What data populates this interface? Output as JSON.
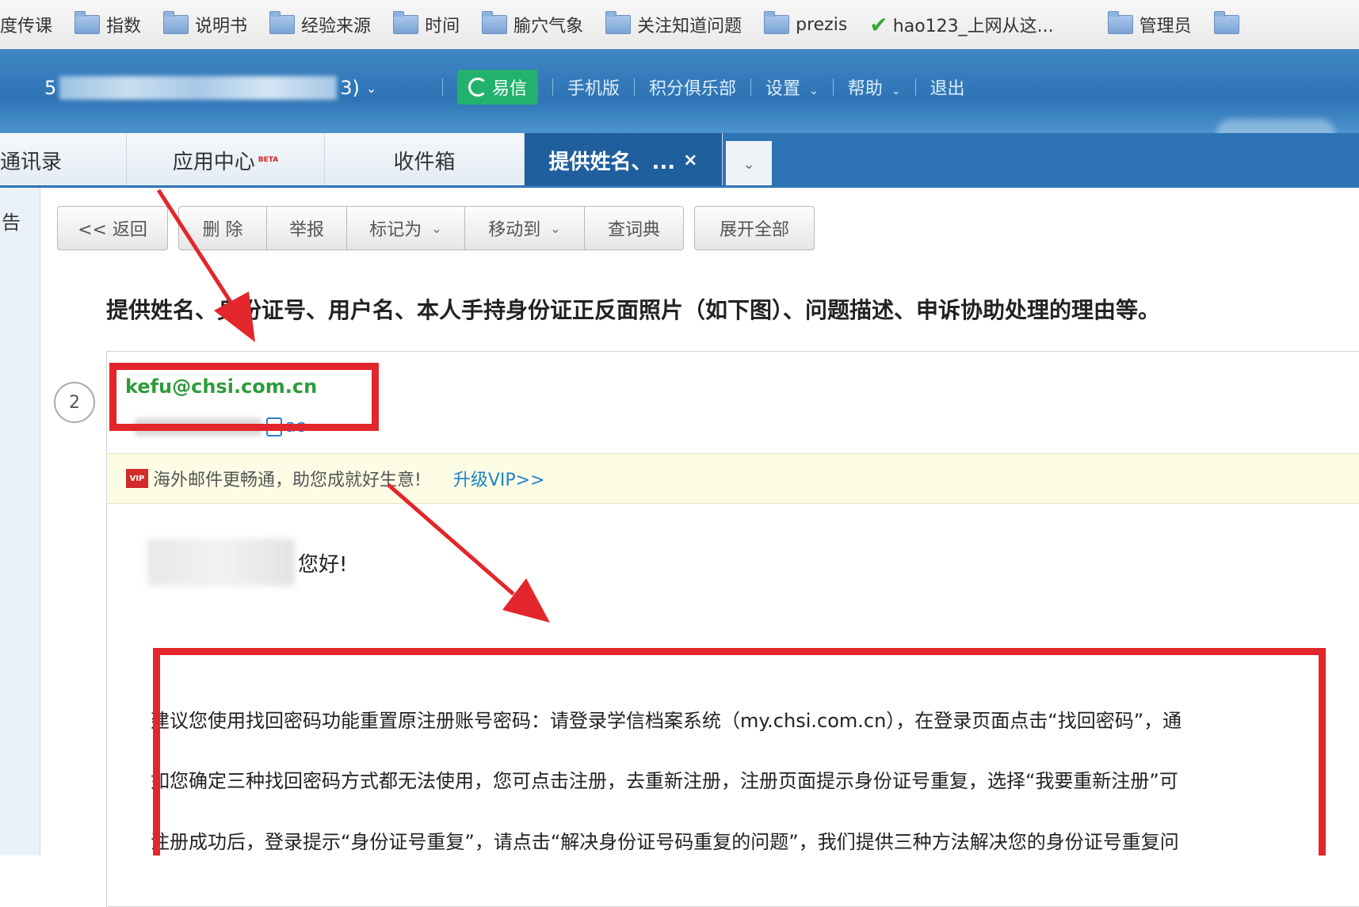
{
  "bookmarks": [
    {
      "label": "度传课",
      "icon": "folder-icon",
      "noicon": true
    },
    {
      "label": "指数",
      "icon": "folder-icon"
    },
    {
      "label": "说明书",
      "icon": "folder-icon"
    },
    {
      "label": "经验来源",
      "icon": "folder-icon"
    },
    {
      "label": "时间",
      "icon": "folder-icon"
    },
    {
      "label": "腧穴气象",
      "icon": "folder-icon"
    },
    {
      "label": "关注知道问题",
      "icon": "folder-icon"
    },
    {
      "label": "prezis",
      "icon": "folder-icon"
    },
    {
      "label": "hao123_上网从这...",
      "icon": "check-icon"
    },
    {
      "label": "管理员",
      "icon": "folder-icon"
    }
  ],
  "header": {
    "account_prefix": "5",
    "account_suffix": "3)",
    "yixin": "易信",
    "nav": [
      "手机版",
      "积分俱乐部",
      "设置",
      "帮助",
      "退出"
    ]
  },
  "tabs": [
    {
      "label": "通讯录"
    },
    {
      "label": "应用中心",
      "badge": "BETA"
    },
    {
      "label": "收件箱"
    },
    {
      "label": "提供姓名、...",
      "active": true
    }
  ],
  "leftstrip": {
    "label": "告"
  },
  "toolbar": {
    "back": "<< 返回",
    "delete": "删 除",
    "report": "举报",
    "mark_as": "标记为",
    "move_to": "移动到",
    "dictionary": "查词典",
    "expand_all": "展开全部"
  },
  "message": {
    "subject": "提供姓名、身份证号、用户名、本人手持身份证正反面照片（如下图）、问题描述、申诉协助处理的理由等。",
    "count": "2",
    "sender": "kefu@chsi.com.cn",
    "recipient": "ao",
    "ad_text": "海外邮件更畅通，助您成就好生意!",
    "ad_link": "升级VIP>>",
    "vip_badge": "VIP",
    "greeting": "您好!",
    "paragraphs": [
      "建议您使用找回密码功能重置原注册账号密码：请登录学信档案系统（my.chsi.com.cn），在登录页面点击“找回密码”，通",
      "如您确定三种找回密码方式都无法使用，您可点击注册，去重新注册，注册页面提示身份证号重复，选择“我要重新注册”可",
      "注册成功后，登录提示“身份证号重复”，请点击“解决身份证号码重复的问题”，我们提供三种方法解决您的身份证号重复问"
    ]
  },
  "colors": {
    "annotation": "#e3262b",
    "sender": "#2e9b3a",
    "header": "#2e74b5"
  }
}
